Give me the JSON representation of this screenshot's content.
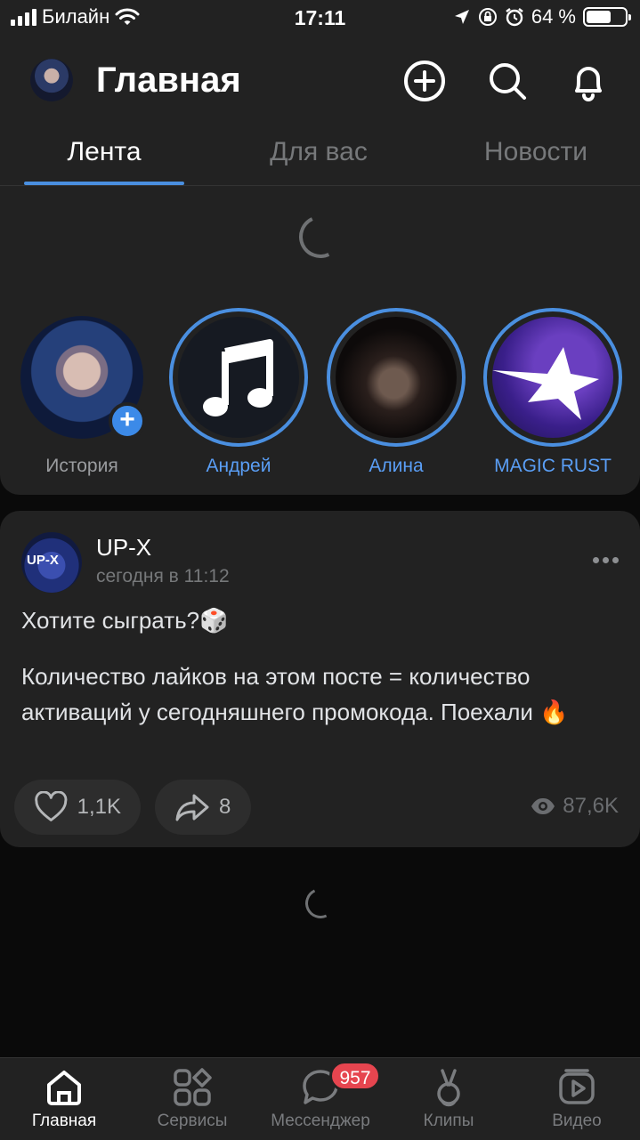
{
  "status_bar": {
    "carrier": "Билайн",
    "time": "17:11",
    "battery_text": "64 %",
    "battery_level": 0.64
  },
  "header": {
    "title": "Главная"
  },
  "tabs": [
    {
      "label": "Лента",
      "active": true
    },
    {
      "label": "Для вас",
      "active": false
    },
    {
      "label": "Новости",
      "active": false
    }
  ],
  "stories": [
    {
      "label": "История",
      "icon": "add-story"
    },
    {
      "label": "Андрей",
      "icon": "music-note-icon"
    },
    {
      "label": "Алина",
      "icon": "photo"
    },
    {
      "label": "MAGIC RUST",
      "icon": "star-icon"
    }
  ],
  "post": {
    "avatar_text": "UP-X",
    "author": "UP-X",
    "time": "сегодня в 11:12",
    "text_line1": "Хотите сыграть?🎲",
    "text_body": "Количество лайков на этом посте = количество активаций у сегодняшнего промокода. Поехали 🔥",
    "likes": "1,1K",
    "shares": "8",
    "views": "87,6K"
  },
  "bottom_nav": [
    {
      "label": "Главная",
      "icon": "home-icon",
      "active": true
    },
    {
      "label": "Сервисы",
      "icon": "services-icon",
      "active": false
    },
    {
      "label": "Мессенджер",
      "icon": "messenger-icon",
      "active": false
    },
    {
      "label": "Клипы",
      "icon": "clips-icon",
      "active": false
    },
    {
      "label": "Видео",
      "icon": "video-icon",
      "active": false
    }
  ],
  "messenger_badge": "957",
  "colors": {
    "accent": "#4a8fe0",
    "badge": "#e6454f",
    "card": "#222222",
    "background": "#0a0a0a"
  }
}
